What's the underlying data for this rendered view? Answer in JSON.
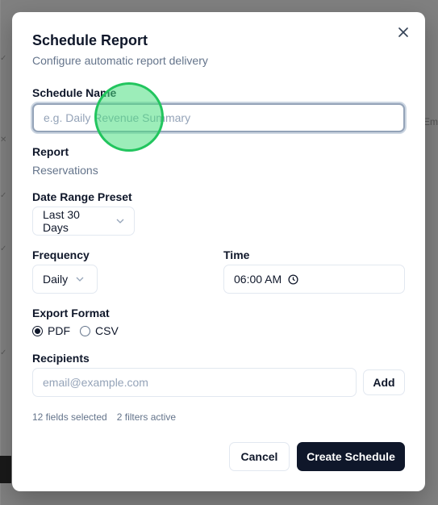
{
  "dialog": {
    "title": "Schedule Report",
    "subtitle": "Configure automatic report delivery"
  },
  "schedule_name": {
    "label": "Schedule Name",
    "placeholder": "e.g. Daily Revenue Summary",
    "value": ""
  },
  "report": {
    "label": "Report",
    "value": "Reservations"
  },
  "date_range": {
    "label": "Date Range Preset",
    "selected": "Last 30 Days"
  },
  "frequency": {
    "label": "Frequency",
    "selected": "Daily"
  },
  "time": {
    "label": "Time",
    "value": "06:00 AM"
  },
  "export_format": {
    "label": "Export Format",
    "options": [
      {
        "label": "PDF",
        "checked": true
      },
      {
        "label": "CSV",
        "checked": false
      }
    ]
  },
  "recipients": {
    "label": "Recipients",
    "placeholder": "email@example.com",
    "add_label": "Add"
  },
  "summary": {
    "fields": "12 fields selected",
    "filters": "2 filters active"
  },
  "footer": {
    "cancel_label": "Cancel",
    "create_label": "Create Schedule"
  },
  "background": {
    "right_text": "Em"
  },
  "colors": {
    "primary": "#0f172a",
    "muted": "#64748b",
    "border": "#e2e8f0",
    "focus_ring": "#94a3b8"
  }
}
